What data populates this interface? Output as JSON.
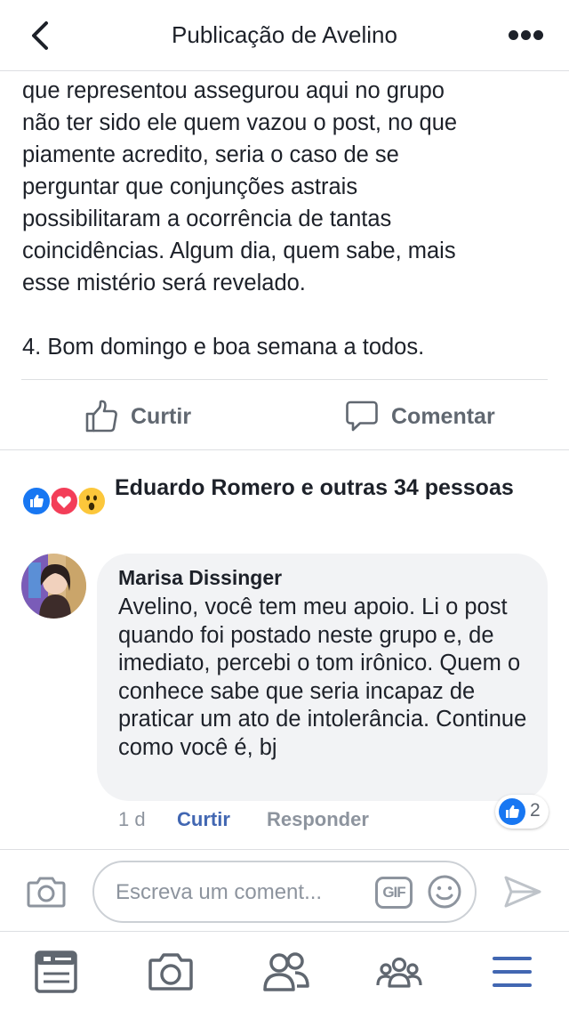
{
  "header": {
    "title": "Publicação de Avelino",
    "back_icon": "chevron-left-icon",
    "more_icon": "more-dots-icon"
  },
  "post": {
    "text": "que representou assegurou aqui no grupo\nnão ter sido ele quem vazou o post, no que\npiamente acredito, seria o caso de se\nperguntar que conjunções astrais\npossibilitaram a ocorrência de tantas\ncoincidências. Algum dia, quem sabe, mais\nesse mistério será revelado.\n\n4. Bom domingo e boa semana a todos."
  },
  "actions": {
    "like_label": "Curtir",
    "comment_label": "Comentar"
  },
  "reactions": {
    "icons": [
      "like-reaction-icon",
      "love-reaction-icon",
      "wow-reaction-icon"
    ],
    "summary": "Eduardo Romero e outras 34 pessoas"
  },
  "comment": {
    "author": "Marisa Dissinger",
    "text": "Avelino, você tem meu apoio. Li o post quando foi postado neste grupo e, de imediato, percebi o tom irônico. Quem o conhece sabe que seria incapaz de praticar um ato de intolerância. Continue como você é, bj",
    "time": "1 d",
    "like_label": "Curtir",
    "reply_label": "Responder",
    "reaction_count": "2"
  },
  "composer": {
    "placeholder": "Escreva um coment...",
    "gif_label": "GIF"
  },
  "tabbar": {
    "items": [
      "news-feed-icon",
      "camera-icon",
      "friends-icon",
      "groups-icon",
      "menu-icon"
    ]
  },
  "colors": {
    "accent": "#4267b2",
    "like_blue": "#1877f2",
    "love_red": "#f33e58",
    "wow_yellow": "#fcc73b",
    "secondary_text": "#606770",
    "bubble_bg": "#f2f3f5",
    "divider": "#dddfe2"
  }
}
